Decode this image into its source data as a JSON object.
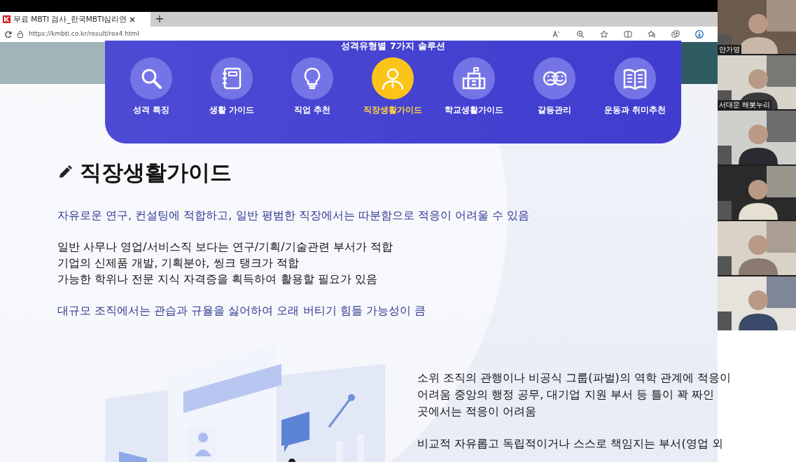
{
  "browser": {
    "tab_title": "무료 MBTI 검사_한국MBTI심리연",
    "url": "https://kmbti.co.kr/result/rex4.html"
  },
  "nav": {
    "title": "성격유형별 7가지 솔루션",
    "items": [
      {
        "label": "성격 특징",
        "selected": false
      },
      {
        "label": "생활 가이드",
        "selected": false
      },
      {
        "label": "직업 추천",
        "selected": false
      },
      {
        "label": "직장생활가이드",
        "selected": true
      },
      {
        "label": "학교생활가이드",
        "selected": false
      },
      {
        "label": "갈등관리",
        "selected": false
      },
      {
        "label": "운동과 취미추천",
        "selected": false
      }
    ]
  },
  "guide": {
    "title": "직장생활가이드",
    "blocks": [
      {
        "kind": "emphasis",
        "lines": [
          "자유로운 연구, 컨설팅에 적합하고, 일반 평범한 직장에서는 따분함으로 적응이 어려울 수 있음"
        ]
      },
      {
        "kind": "plain",
        "lines": [
          "일반 사무나 영업/서비스직 보다는 연구/기획/기술관련 부서가 적합",
          "기업의 신제품 개발, 기획분야, 씽크 탱크가 적합",
          "가능한 학위나 전문 지식 자격증을 획득하여 활용할 필요가 있음"
        ]
      },
      {
        "kind": "emphasis",
        "lines": [
          "대규모 조직에서는 관습과 규율을 싫어하여 오래 버티기 힘들 가능성이 큼"
        ]
      }
    ],
    "details": [
      [
        "소위 조직의 관행이나 비공식 그룹(파벌)의 역학 관계에 적응이",
        "어려움 중앙의 행정 공무, 대기업 지원 부서 등 틀이 꽉 짜인",
        "곳에서는 적응이 어려움"
      ],
      [
        "비교적 자유롭고 독립적이거나 스스로 책임지는 부서(영업 외"
      ]
    ]
  },
  "participants": [
    {
      "kind": "picture",
      "name": "안가영"
    },
    {
      "kind": "picture",
      "name": "서대문 해봇누리"
    },
    {
      "kind": "picture"
    },
    {
      "kind": "picture"
    },
    {
      "kind": "picture"
    },
    {
      "kind": "picture"
    }
  ]
}
